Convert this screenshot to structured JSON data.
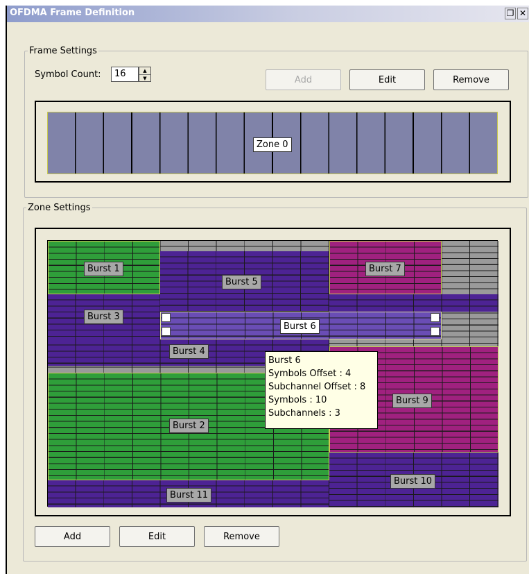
{
  "window": {
    "title": "OFDMA Frame Definition",
    "restore_icon": "restore-icon",
    "close_icon": "close-icon",
    "restore_glyph": "2",
    "close_glyph": "×"
  },
  "frame_settings": {
    "legend": "Frame Settings",
    "symbol_count_label": "Symbol Count:",
    "symbol_count_value": "16",
    "add_label": "Add",
    "edit_label": "Edit",
    "remove_label": "Remove",
    "zone_label": "Zone 0"
  },
  "zone_settings": {
    "legend": "Zone Settings",
    "bursts": [
      {
        "label": "Burst 1",
        "color": "#2f9e3a"
      },
      {
        "label": "Burst 2",
        "color": "#2f9e3a"
      },
      {
        "label": "Burst 3",
        "color": "#4d2394"
      },
      {
        "label": "Burst 4",
        "color": "#4d2394"
      },
      {
        "label": "Burst 5",
        "color": "#4d2394"
      },
      {
        "label": "Burst 6",
        "color": "#6a4db5"
      },
      {
        "label": "Burst 7",
        "color": "#a0217f"
      },
      {
        "label": "Burst 9",
        "color": "#a0217f"
      },
      {
        "label": "Burst 10",
        "color": "#4d2394"
      },
      {
        "label": "Burst 11",
        "color": "#4d2394"
      }
    ],
    "tooltip": {
      "lines": [
        "Burst 6",
        "Symbols Offset : 4",
        "Subchannel Offset : 8",
        "Symbols : 10",
        "Subchannels : 3"
      ]
    },
    "add_label": "Add",
    "edit_label": "Edit",
    "remove_label": "Remove"
  },
  "colors": {
    "green": "#2f9e3a",
    "purple": "#4d2394",
    "light_purple": "#6a4db5",
    "magenta": "#a0217f",
    "gray": "#9a9a9a",
    "zone": "#8083a9"
  }
}
